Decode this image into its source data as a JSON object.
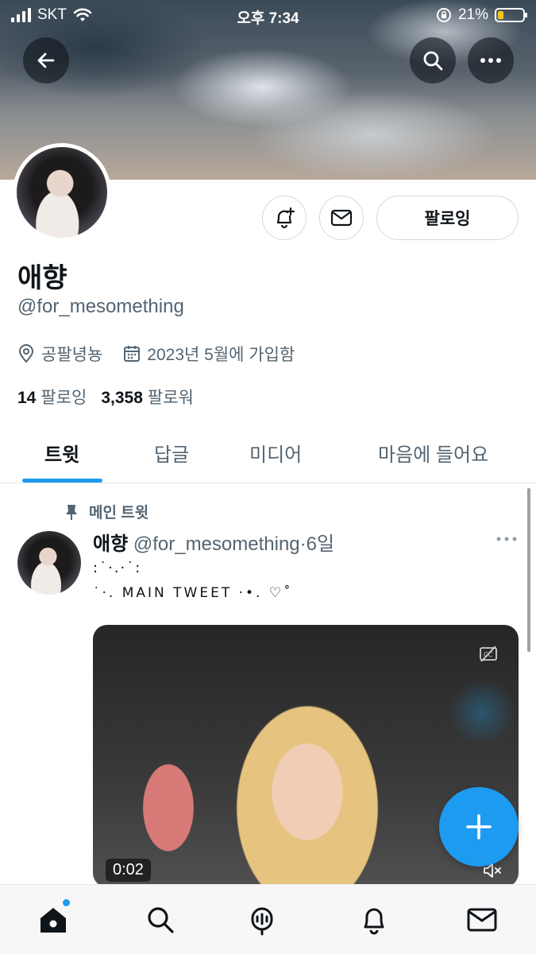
{
  "status_bar": {
    "carrier": "SKT",
    "time": "오후 7:34",
    "battery_percent": "21%",
    "battery_level": 0.21
  },
  "header": {
    "back": "back-arrow-icon",
    "search": "search-icon",
    "more": "more-icon"
  },
  "profile": {
    "name": "애향",
    "handle": "@for_mesomething",
    "location": "공팔녕뇽",
    "joined": "2023년 5월에 가입함",
    "following_count": "14",
    "following_label": "팔로잉",
    "followers_count": "3,358",
    "followers_label": "팔로워",
    "follow_button": "팔로잉"
  },
  "tabs": [
    {
      "label": "트윗",
      "active": true
    },
    {
      "label": "답글",
      "active": false
    },
    {
      "label": "미디어",
      "active": false
    },
    {
      "label": "마음에 들어요",
      "active": false
    }
  ],
  "tweet": {
    "pinned_label": "메인 트윗",
    "author_name": "애향",
    "author_handle": "@for_mesomething",
    "separator": "·",
    "time": "6일",
    "line1": ":˙·.·˙:",
    "line2": "˙·. MAIN TWEET ·•. ♡˚",
    "media_duration": "0:02"
  },
  "colors": {
    "accent": "#1d9bf0",
    "text": "#0f1419",
    "secondary": "#536471",
    "border": "#cfd9de"
  },
  "bottom_nav": [
    "home-icon",
    "search-icon",
    "spaces-icon",
    "notifications-icon",
    "messages-icon"
  ]
}
